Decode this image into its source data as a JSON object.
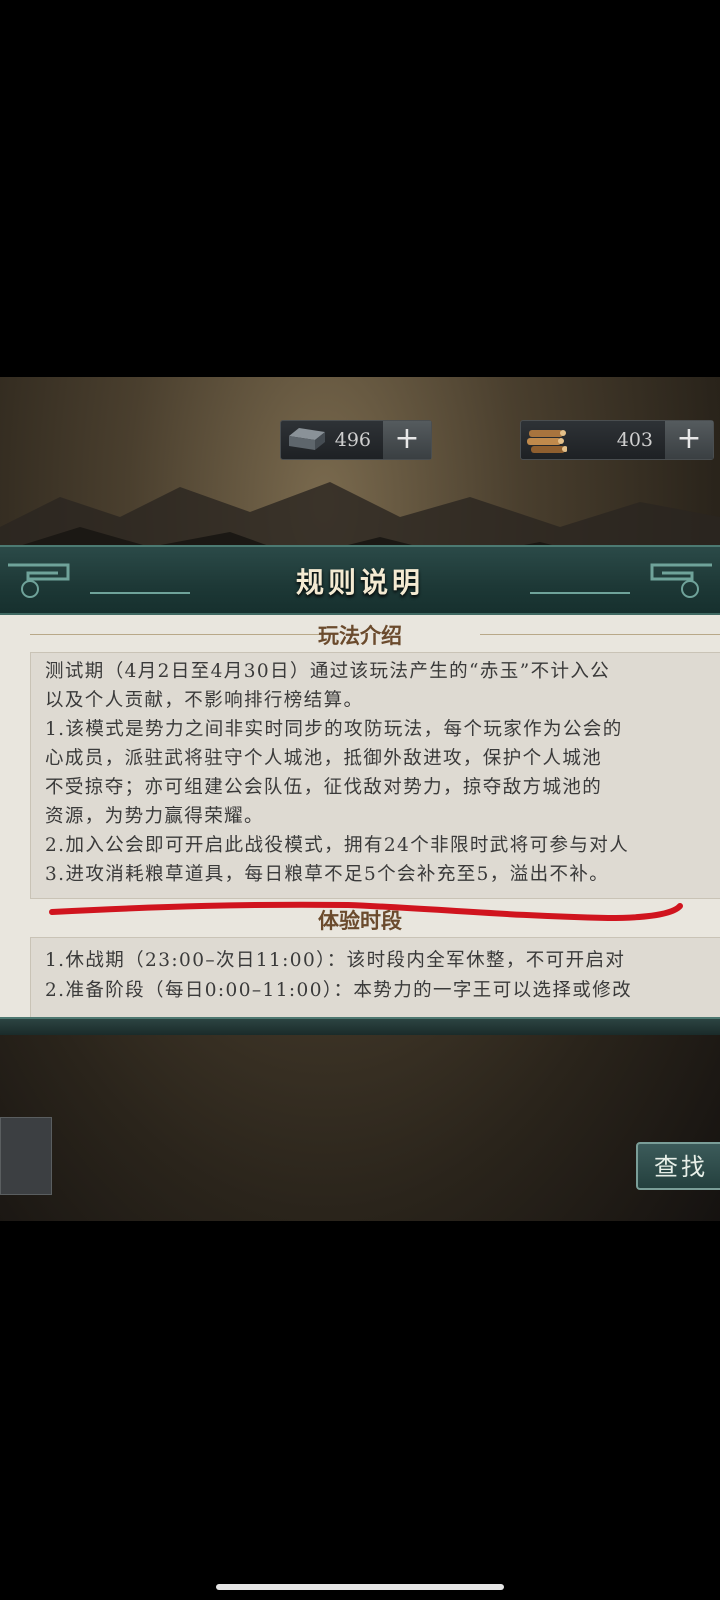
{
  "resources": [
    {
      "icon": "iron-ingot-icon",
      "value": "496"
    },
    {
      "icon": "wood-logs-icon",
      "value": "403"
    }
  ],
  "plus_label": "+",
  "dialog": {
    "title": "规则说明",
    "section1": {
      "title": "玩法介绍",
      "lines": [
        "测试期（4月2日至4月30日）通过该玩法产生的“赤玉”不计入公",
        "以及个人贡献，不影响排行榜结算。",
        "1.该模式是势力之间非实时同步的攻防玩法，每个玩家作为公会的",
        "心成员，派驻武将驻守个人城池，抵御外敌进攻，保护个人城池",
        "不受掠夺；亦可组建公会队伍，征伐敌对势力，掠夺敌方城池的",
        "资源，为势力赢得荣耀。",
        "2.加入公会即可开启此战役模式，拥有24个非限时武将可参与对人",
        "3.进攻消耗粮草道具，每日粮草不足5个会补充至5，溢出不补。"
      ]
    },
    "section2": {
      "title": "体验时段",
      "lines": [
        "1.休战期（23:00–次日11:00）：该时段内全军休整，不可开启对",
        "2.准备阶段（每日0:00–11:00）：本势力的一字王可以选择或修改"
      ]
    }
  },
  "search_button": "查找",
  "colors": {
    "annotation": "#d0141e",
    "panel": "#e9e6de",
    "banner": "#1d3836"
  }
}
